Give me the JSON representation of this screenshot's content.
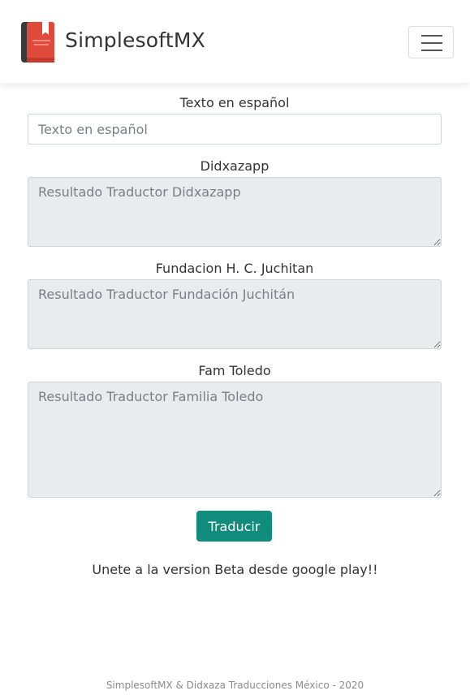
{
  "header": {
    "brand_name": "SimplesoftMX",
    "logo_icon": "red-book-icon",
    "menu_icon": "hamburger-menu-icon"
  },
  "form": {
    "spanish_label": "Texto en español",
    "spanish_placeholder": "Texto en español",
    "spanish_value": "",
    "didxazapp_label": "Didxazapp",
    "didxazapp_placeholder": "Resultado Traductor Didxazapp",
    "fundacion_label": "Fundacion H. C. Juchitan",
    "fundacion_placeholder": "Resultado Traductor Fundación Juchitán",
    "toledo_label": "Fam Toledo",
    "toledo_placeholder": "Resultado Traductor Familia Toledo",
    "translate_button": "Traducir"
  },
  "promo": {
    "beta_text": "Unete a la version Beta desde google play!!"
  },
  "footer": {
    "text": "SimplesoftMX & Didxaza Traducciones México - 2020"
  },
  "colors": {
    "accent": "#0f8c7c",
    "logo_red": "#e04a3a",
    "output_bg": "#e9ecef"
  }
}
